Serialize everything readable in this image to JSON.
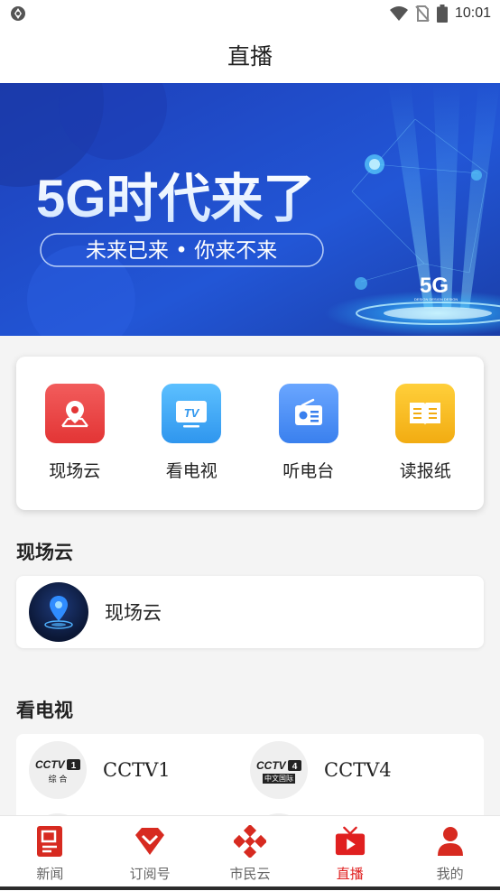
{
  "status_bar": {
    "time": "10:01"
  },
  "header": {
    "title": "直播"
  },
  "banner": {
    "headline": "5G时代来了",
    "subline": "未来已来 • 你来不来",
    "badge": "5G",
    "badge_caption": "DESIGN DESIGN DESIGN"
  },
  "shortcuts": [
    {
      "label": "现场云",
      "icon": "map-pin-icon",
      "color": "#ea3a3a"
    },
    {
      "label": "看电视",
      "icon": "tv-icon",
      "color": "#3aa8f0"
    },
    {
      "label": "听电台",
      "icon": "radio-icon",
      "color": "#3f8ef5"
    },
    {
      "label": "读报纸",
      "icon": "newspaper-icon",
      "color": "#f6b91f"
    }
  ],
  "sections": {
    "live_cloud": {
      "title": "现场云",
      "item_label": "现场云"
    },
    "tv": {
      "title": "看电视",
      "channels": [
        {
          "name": "CCTV1",
          "logo_text": "CCTV1",
          "logo_sub": "综 合"
        },
        {
          "name": "CCTV4",
          "logo_text": "CCTV4",
          "logo_sub": "中文国际"
        }
      ]
    }
  },
  "tabs": [
    {
      "label": "新闻",
      "icon": "news-icon",
      "active": false
    },
    {
      "label": "订阅号",
      "icon": "subscribe-icon",
      "active": false
    },
    {
      "label": "市民云",
      "icon": "citizen-cloud-icon",
      "active": false
    },
    {
      "label": "直播",
      "icon": "live-tv-icon",
      "active": true
    },
    {
      "label": "我的",
      "icon": "profile-icon",
      "active": false
    }
  ],
  "colors": {
    "accent": "#e02020",
    "banner_bg": "#1f4fd0"
  }
}
